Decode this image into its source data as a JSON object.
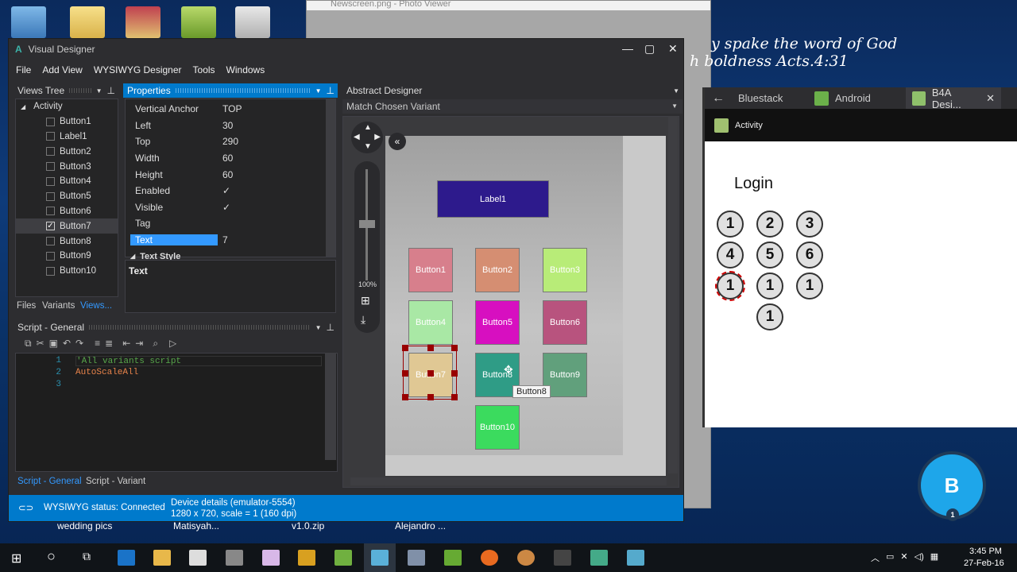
{
  "desktop": {
    "quote_line1": "y spake the word of God",
    "quote_line2": "h boldness   Acts.4:31",
    "labels": [
      "wedding pics",
      "Matisyah...",
      "v1.0.zip",
      "Alejandro ..."
    ]
  },
  "photo_viewer": {
    "title": "Newscreen.png - Photo Viewer"
  },
  "bluestacks": {
    "tabs": [
      "Bluestack",
      "Android",
      "B4A Desi..."
    ],
    "activity_title": "Activity",
    "login_label": "Login",
    "circles": [
      "1",
      "2",
      "3",
      "4",
      "5",
      "6",
      "1",
      "1",
      "1",
      "1"
    ],
    "badge_letter": "B",
    "badge_count": "1"
  },
  "window": {
    "title": "Visual Designer",
    "logo": "A",
    "menu": [
      "File",
      "Add View",
      "WYSIWYG Designer",
      "Tools",
      "Windows"
    ]
  },
  "views_tree": {
    "header": "Views Tree",
    "root": "Activity",
    "items": [
      {
        "label": "Button1",
        "checked": false
      },
      {
        "label": "Label1",
        "checked": false
      },
      {
        "label": "Button2",
        "checked": false
      },
      {
        "label": "Button3",
        "checked": false
      },
      {
        "label": "Button4",
        "checked": false
      },
      {
        "label": "Button5",
        "checked": false
      },
      {
        "label": "Button6",
        "checked": false
      },
      {
        "label": "Button7",
        "checked": true
      },
      {
        "label": "Button8",
        "checked": false
      },
      {
        "label": "Button9",
        "checked": false
      },
      {
        "label": "Button10",
        "checked": false
      }
    ],
    "tabs": [
      "Files",
      "Variants",
      "Views..."
    ]
  },
  "properties": {
    "header": "Properties",
    "rows": [
      {
        "key": "Vertical Anchor",
        "value": "TOP"
      },
      {
        "key": "Left",
        "value": "30"
      },
      {
        "key": "Top",
        "value": "290"
      },
      {
        "key": "Width",
        "value": "60"
      },
      {
        "key": "Height",
        "value": "60"
      },
      {
        "key": "Enabled",
        "value": "✓"
      },
      {
        "key": "Visible",
        "value": "✓"
      },
      {
        "key": "Tag",
        "value": ""
      },
      {
        "key": "Text",
        "value": "7"
      }
    ],
    "section": "Text Style",
    "description_title": "Text"
  },
  "script": {
    "header": "Script - General",
    "lines": [
      "'All variants script",
      "AutoScaleAll",
      ""
    ],
    "line_numbers": [
      "1",
      "2",
      "3"
    ],
    "tabs": [
      "Script - General",
      "Script - Variant"
    ]
  },
  "abstract_designer": {
    "header": "Abstract Designer",
    "variant": "Match Chosen Variant",
    "zoom": "100%",
    "label1": "Label1",
    "tooltip": "Button8",
    "buttons": [
      {
        "label": "Button1",
        "color": "#d77f8c"
      },
      {
        "label": "Button2",
        "color": "#d58e72"
      },
      {
        "label": "Button3",
        "color": "#b8ec78"
      },
      {
        "label": "Button4",
        "color": "#a9e8a5"
      },
      {
        "label": "Button5",
        "color": "#d70fc0"
      },
      {
        "label": "Button6",
        "color": "#b8537e"
      },
      {
        "label": "Button7",
        "color": "#e0c894"
      },
      {
        "label": "Button8",
        "color": "#2f9c86"
      },
      {
        "label": "Button9",
        "color": "#61a07c"
      },
      {
        "label": "Button10",
        "color": "#3bdb5e"
      }
    ]
  },
  "status_bar": {
    "status": "WYSIWYG status: Connected",
    "device_line1": "Device details (emulator-5554)",
    "device_line2": "1280 x 720, scale = 1 (160 dpi)"
  },
  "taskbar": {
    "time": "3:45 PM",
    "date": "27-Feb-16"
  }
}
